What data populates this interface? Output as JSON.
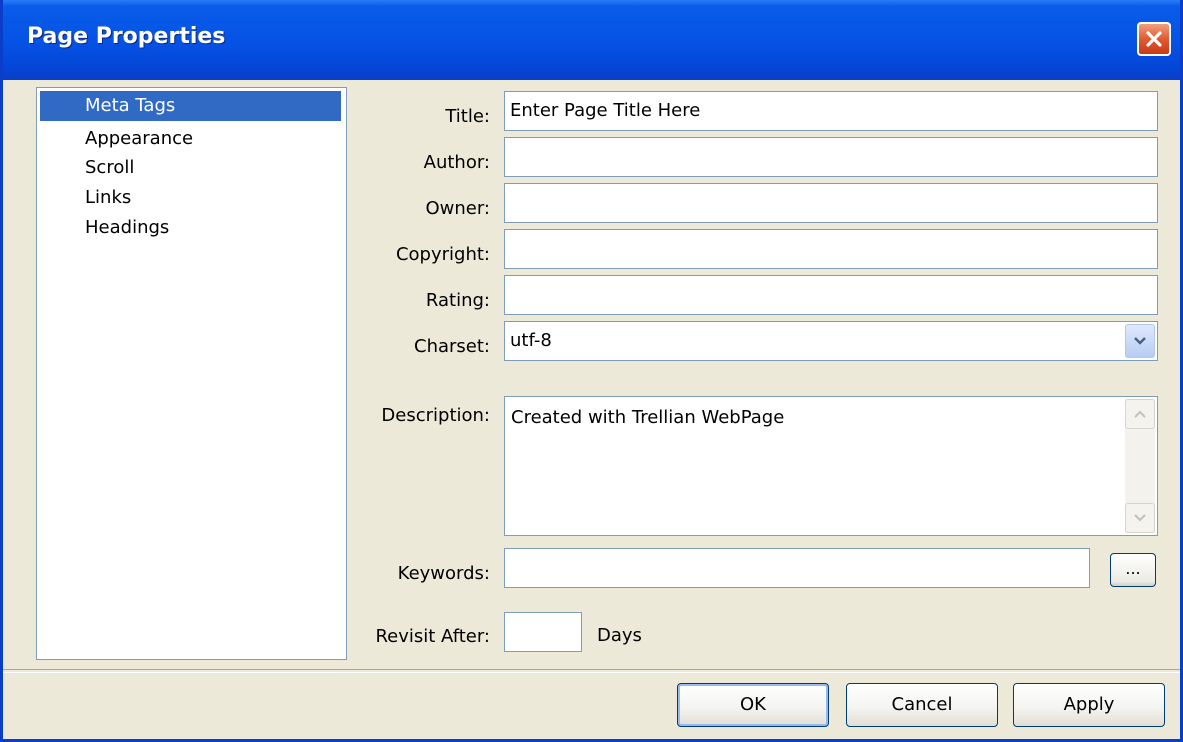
{
  "window": {
    "title": "Page Properties"
  },
  "nav": {
    "items": [
      {
        "label": "Meta Tags",
        "selected": true
      },
      {
        "label": "Appearance"
      },
      {
        "label": "Scroll"
      },
      {
        "label": "Links"
      },
      {
        "label": "Headings"
      }
    ]
  },
  "form": {
    "title_label": "Title:",
    "title_value": "Enter Page Title Here",
    "author_label": "Author:",
    "author_value": "",
    "owner_label": "Owner:",
    "owner_value": "",
    "copyright_label": "Copyright:",
    "copyright_value": "",
    "rating_label": "Rating:",
    "rating_value": "",
    "charset_label": "Charset:",
    "charset_value": "utf-8",
    "description_label": "Description:",
    "description_value": "Created with Trellian WebPage",
    "keywords_label": "Keywords:",
    "keywords_value": "",
    "keywords_browse_label": "...",
    "revisit_label": "Revisit After:",
    "revisit_value": "",
    "days_label": "Days"
  },
  "buttons": {
    "ok": "OK",
    "cancel": "Cancel",
    "apply": "Apply"
  },
  "colors": {
    "titlebar": "#0653e6",
    "selection": "#316ac5",
    "dialog_bg": "#ece9d8",
    "close": "#e05a30"
  },
  "icons": {
    "close": "close-icon",
    "dropdown": "chevron-down-icon",
    "scroll_up": "arrow-up-icon",
    "scroll_down": "arrow-down-icon"
  }
}
